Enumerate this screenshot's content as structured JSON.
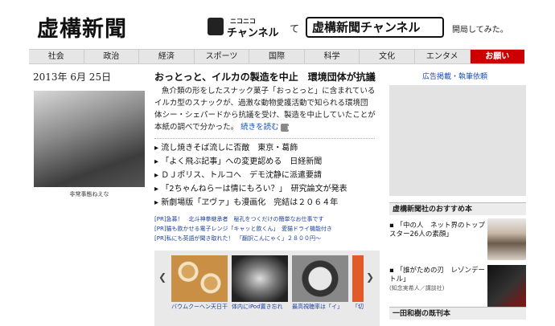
{
  "header": {
    "logo": "虚構新聞",
    "nico_small": "ニコニコ",
    "nico_big": "チャンネル",
    "te": "て",
    "channel": "虚構新聞チャンネル",
    "opened": "開局してみた。"
  },
  "nav": {
    "items": [
      "社会",
      "政治",
      "経済",
      "スポーツ",
      "国際",
      "科学",
      "文化",
      "エンタメ",
      "お願い"
    ],
    "highlight_color": "#cc0000"
  },
  "left": {
    "date": "2013年 6月 25日",
    "photo_caption": "非常事態ねえな"
  },
  "article": {
    "headline": "おっとっと、イルカの製造を中止　環境団体が抗議",
    "body": "魚介類の形をしたスナック菓子「おっとっと」に含まれているイルカ型のスナックが、過激な動物愛護活動で知られる環境団体シー・シェパードから抗議を受け、製造を中止していたことが本紙の調べで分かった。",
    "more": "続きを読む"
  },
  "related": [
    "流し焼きそば流しに否敵　東京・葛飾",
    "「よく飛ぶ記事」への変更認める　日経新聞",
    "ＤＪポリス、トルコへ　デモ沈静に派遣要請",
    "「2ちゃんねらーは情にもろい？」　研究論文が発表",
    "新劇場版「ヱヴァ」も漫画化　完結は２０６４年"
  ],
  "pr": [
    "[PR]急募！　北斗神拳継承者　秘孔をつくだけの簡単なお仕事です",
    "[PR]猫も飲かせる電子レンジ「キャッと飲くん」　愛猫ドライ機能付き",
    "[PR]私にも英語が聞き取れた！　「翻訳こんにゃく」２８００円～"
  ],
  "thumbs": [
    {
      "caption": "バウムクーヘン天日干し"
    },
    {
      "caption": "体内にiPod置き忘れ"
    },
    {
      "caption": "最高視聴率は「イ」"
    },
    {
      "caption": "「切"
    }
  ],
  "right": {
    "ad_link": "広告掲載・執筆依頼",
    "recommend_title": "虚構新聞社のおすすめ本",
    "books": [
      {
        "title": "「中の人　ネット界のトップスター26人の素顔」",
        "sub": ""
      },
      {
        "title": "「誰がための刃　レゾンデートル」",
        "sub": "(知念実希人／講談社)"
      }
    ],
    "tanaka_title": "一田和樹の既刊本"
  }
}
